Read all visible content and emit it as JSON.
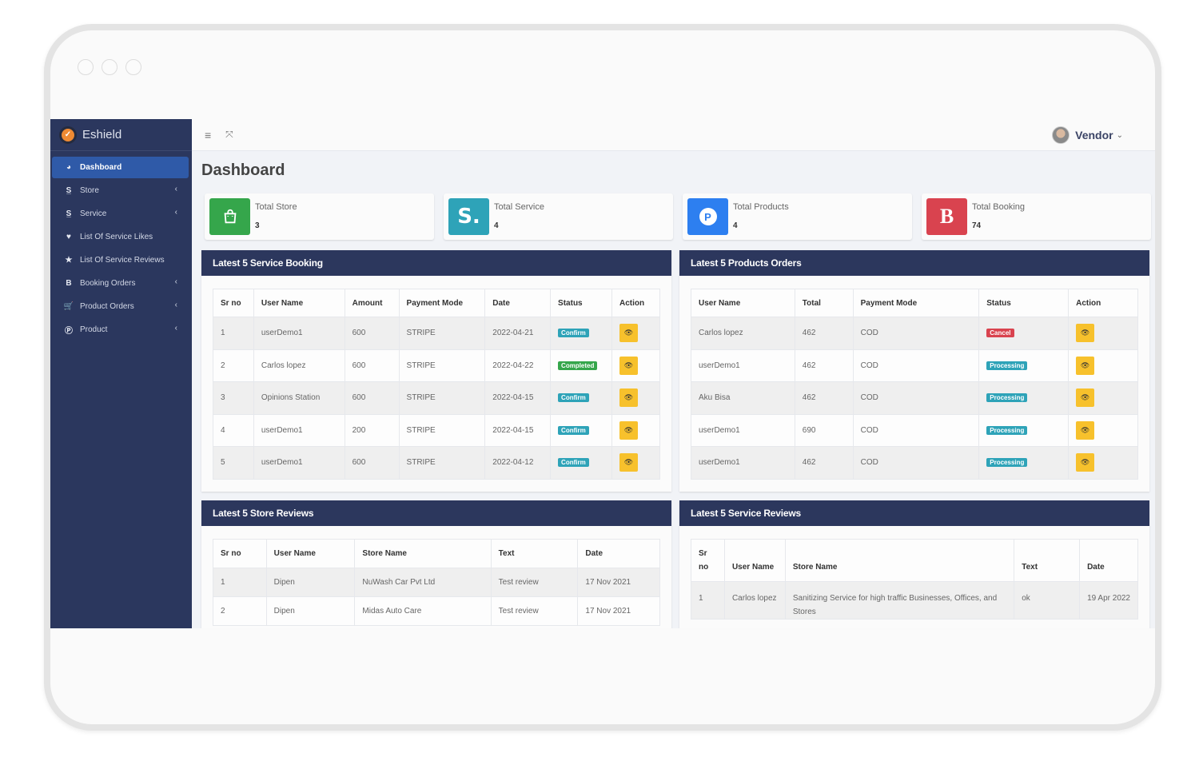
{
  "window": {
    "controls": [
      "close",
      "minimize",
      "maximize"
    ]
  },
  "brand": {
    "name": "Eshield",
    "logo_icon": "shield-check-icon"
  },
  "sidebar": {
    "items": [
      {
        "label": "Dashboard",
        "icon": "tachometer-icon",
        "glyph": "◕",
        "active": true,
        "has_submenu": false
      },
      {
        "label": "Store",
        "icon": "store-s-icon",
        "glyph": "S̲",
        "active": false,
        "has_submenu": true
      },
      {
        "label": "Service",
        "icon": "service-s-icon",
        "glyph": "S̲",
        "active": false,
        "has_submenu": true
      },
      {
        "label": "List Of Service Likes",
        "icon": "heart-icon",
        "glyph": "♥",
        "active": false,
        "has_submenu": false
      },
      {
        "label": "List Of Service Reviews",
        "icon": "star-icon",
        "glyph": "★",
        "active": false,
        "has_submenu": false
      },
      {
        "label": "Booking Orders",
        "icon": "booking-b-icon",
        "glyph": "B",
        "active": false,
        "has_submenu": true
      },
      {
        "label": "Product Orders",
        "icon": "cart-icon",
        "glyph": "🛒",
        "active": false,
        "has_submenu": true
      },
      {
        "label": "Product",
        "icon": "product-p-icon",
        "glyph": "Ⓟ",
        "active": false,
        "has_submenu": true
      }
    ],
    "chevron_glyph": "‹"
  },
  "topbar": {
    "menu_glyph": "≡",
    "fullscreen_glyph": "⤧",
    "user": {
      "name": "Vendor",
      "caret": "⌄"
    }
  },
  "page": {
    "title": "Dashboard"
  },
  "stats": [
    {
      "label": "Total Store",
      "value": "3",
      "color": "#35a64b",
      "glyph": "👜",
      "icon": "shopping-bag-icon"
    },
    {
      "label": "Total Service",
      "value": "4",
      "color": "#2ea3b8",
      "glyph": "S.",
      "icon": "service-icon"
    },
    {
      "label": "Total Products",
      "value": "4",
      "color": "#2d7ff0",
      "glyph": "P",
      "icon": "product-icon"
    },
    {
      "label": "Total Booking",
      "value": "74",
      "color": "#d9434f",
      "glyph": "B",
      "icon": "booking-icon"
    }
  ],
  "service_booking": {
    "title": "Latest 5 Service Booking",
    "columns": [
      "Sr no",
      "User Name",
      "Amount",
      "Payment Mode",
      "Date",
      "Status",
      "Action"
    ],
    "rows": [
      {
        "sr": "1",
        "user": "userDemo1",
        "amount": "600",
        "mode": "STRIPE",
        "date": "2022-04-21",
        "status": "Confirm"
      },
      {
        "sr": "2",
        "user": "Carlos lopez",
        "amount": "600",
        "mode": "STRIPE",
        "date": "2022-04-22",
        "status": "Completed"
      },
      {
        "sr": "3",
        "user": "Opinions Station",
        "amount": "600",
        "mode": "STRIPE",
        "date": "2022-04-15",
        "status": "Confirm"
      },
      {
        "sr": "4",
        "user": "userDemo1",
        "amount": "200",
        "mode": "STRIPE",
        "date": "2022-04-15",
        "status": "Confirm"
      },
      {
        "sr": "5",
        "user": "userDemo1",
        "amount": "600",
        "mode": "STRIPE",
        "date": "2022-04-12",
        "status": "Confirm"
      }
    ]
  },
  "product_orders": {
    "title": "Latest 5 Products Orders",
    "columns": [
      "User Name",
      "Total",
      "Payment Mode",
      "Status",
      "Action"
    ],
    "rows": [
      {
        "user": "Carlos lopez",
        "total": "462",
        "mode": "COD",
        "status": "Cancel"
      },
      {
        "user": "userDemo1",
        "total": "462",
        "mode": "COD",
        "status": "Processing"
      },
      {
        "user": "Aku Bisa",
        "total": "462",
        "mode": "COD",
        "status": "Processing"
      },
      {
        "user": "userDemo1",
        "total": "690",
        "mode": "COD",
        "status": "Processing"
      },
      {
        "user": "userDemo1",
        "total": "462",
        "mode": "COD",
        "status": "Processing"
      }
    ]
  },
  "store_reviews": {
    "title": "Latest 5 Store Reviews",
    "columns": [
      "Sr no",
      "User Name",
      "Store Name",
      "Text",
      "Date"
    ],
    "rows": [
      {
        "sr": "1",
        "user": "Dipen",
        "store": "NuWash Car Pvt Ltd",
        "text": "Test review",
        "date": "17 Nov 2021"
      },
      {
        "sr": "2",
        "user": "Dipen",
        "store": "Midas Auto Care",
        "text": "Test review",
        "date": "17 Nov 2021"
      }
    ]
  },
  "service_reviews": {
    "title": "Latest 5 Service Reviews",
    "columns": [
      "Sr no",
      "User Name",
      "Store Name",
      "Text",
      "Date"
    ],
    "rows": [
      {
        "sr": "1",
        "user": "Carlos lopez",
        "store": "Sanitizing Service for high traffic Businesses, Offices, and Stores",
        "text": "ok",
        "date": "19 Apr 2022"
      }
    ]
  },
  "status_colors": {
    "Confirm": "#2ea3b8",
    "Completed": "#35a64b",
    "Processing": "#2ea3b8",
    "Cancel": "#d9434f"
  },
  "action": {
    "label": "view",
    "glyph": "👁"
  }
}
